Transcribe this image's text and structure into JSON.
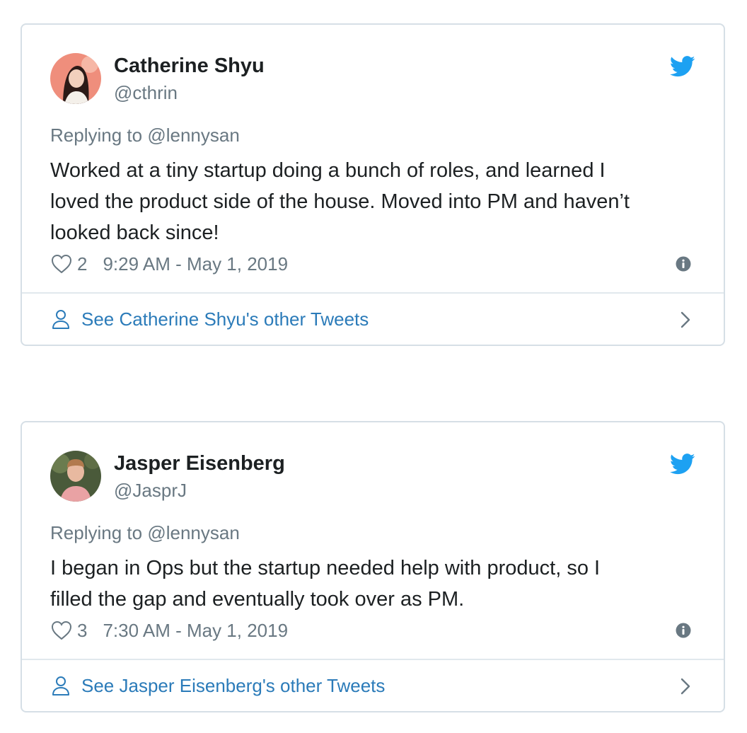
{
  "colors": {
    "text": "#1c2022",
    "muted": "#697882",
    "link": "#2b7bb9",
    "twitter_blue": "#1da1f2",
    "border": "#d6dfe6"
  },
  "icons": {
    "logo": "twitter-bird-icon",
    "like": "heart-outline-icon",
    "info": "info-circle-icon",
    "profile": "person-outline-icon",
    "more": "chevron-right-icon"
  },
  "tweets": [
    {
      "name": "Catherine Shyu",
      "handle": "@cthrin",
      "replying_prefix": "Replying to",
      "replying_to": "@lennysan",
      "lines": [
        "Worked at a tiny startup doing a bunch of roles, and learned I",
        "loved the product side of the house. Moved into PM and haven’t",
        "looked back since!"
      ],
      "likes": "2",
      "timestamp": "9:29 AM - May 1, 2019",
      "footer_link": "See Catherine Shyu's other Tweets"
    },
    {
      "name": "Jasper Eisenberg",
      "handle": "@JasprJ",
      "replying_prefix": "Replying to",
      "replying_to": "@lennysan",
      "lines": [
        "I began in Ops but the startup needed help with product, so I",
        "filled the gap and eventually took over as PM."
      ],
      "likes": "3",
      "timestamp": "7:30 AM - May 1, 2019",
      "footer_link": "See Jasper Eisenberg's other Tweets"
    }
  ]
}
